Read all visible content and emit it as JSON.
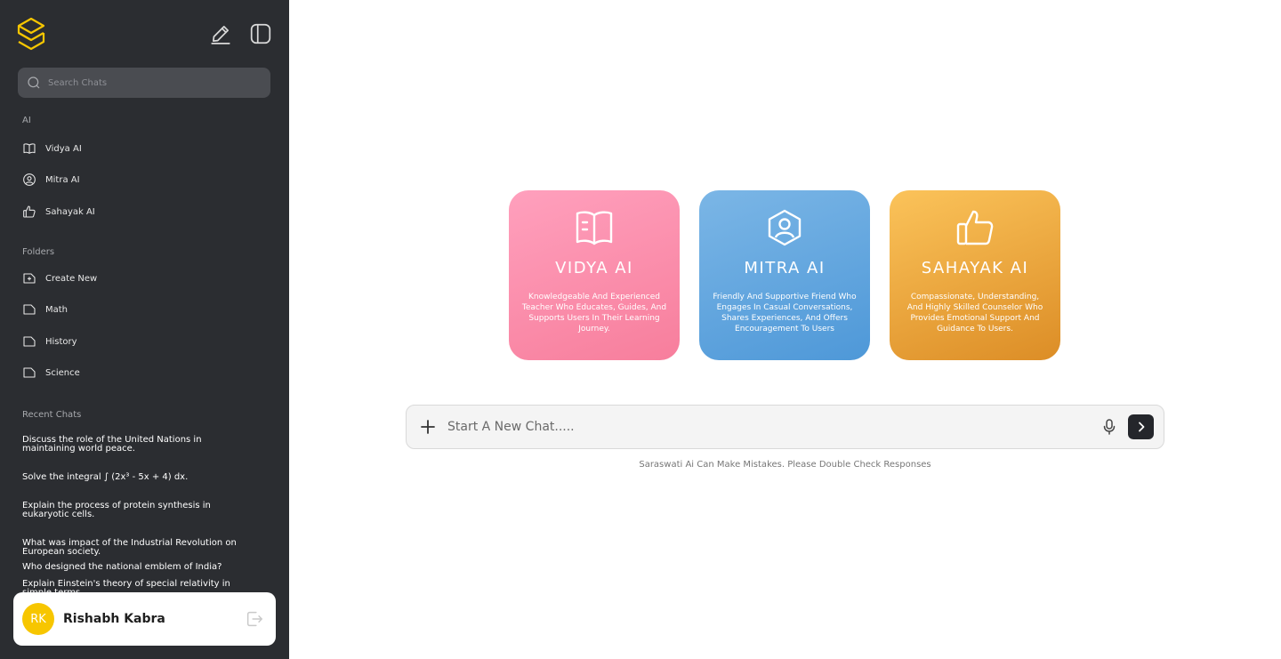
{
  "sidebar": {
    "search_placeholder": "Search Chats",
    "ai_section_label": "AI",
    "ai_items": [
      {
        "label": "Vidya AI",
        "icon": "book-icon"
      },
      {
        "label": "Mitra AI",
        "icon": "person-icon"
      },
      {
        "label": "Sahayak AI",
        "icon": "thumbs-up-icon"
      }
    ],
    "folders_label": "Folders",
    "folders": [
      {
        "label": "Create New",
        "icon": "folder-plus-icon"
      },
      {
        "label": "Math",
        "icon": "folder-icon"
      },
      {
        "label": "History",
        "icon": "folder-icon"
      },
      {
        "label": "Science",
        "icon": "folder-icon"
      }
    ],
    "recent_label": "Recent Chats",
    "recent_chats": [
      "Discuss the role of the United Nations in maintaining world peace.",
      "Solve the integral ∫ (2x³ - 5x + 4) dx.",
      "Explain the process of protein synthesis in eukaryotic cells.",
      "What was impact of the Industrial Revolution on European society.",
      "Who designed the national emblem of India?",
      "Explain Einstein's theory of special relativity in simple terms."
    ],
    "user": {
      "initials": "RK",
      "name": "Rishabh Kabra"
    }
  },
  "cards": [
    {
      "title": "VIDYA AI",
      "description": "Knowledgeable And Experienced Teacher Who Educates, Guides, And Supports Users In Their Learning Journey."
    },
    {
      "title": "MITRA AI",
      "description": "Friendly And Supportive Friend Who Engages In Casual Conversations, Shares Experiences, And Offers Encouragement To Users"
    },
    {
      "title": "SAHAYAK AI",
      "description": "Compassionate, Understanding, And Highly Skilled Counselor Who Provides Emotional Support And Guidance To Users."
    }
  ],
  "chat": {
    "placeholder": "Start A New Chat.....",
    "disclaimer": "Saraswati Ai Can Make Mistakes. Please Double Check Responses"
  },
  "colors": {
    "sidebar_bg": "#2b2d31",
    "vidya": "#f77e9c",
    "mitra": "#4e98d8",
    "sahayak": "#dc8d26",
    "logo": "#f7c600"
  }
}
